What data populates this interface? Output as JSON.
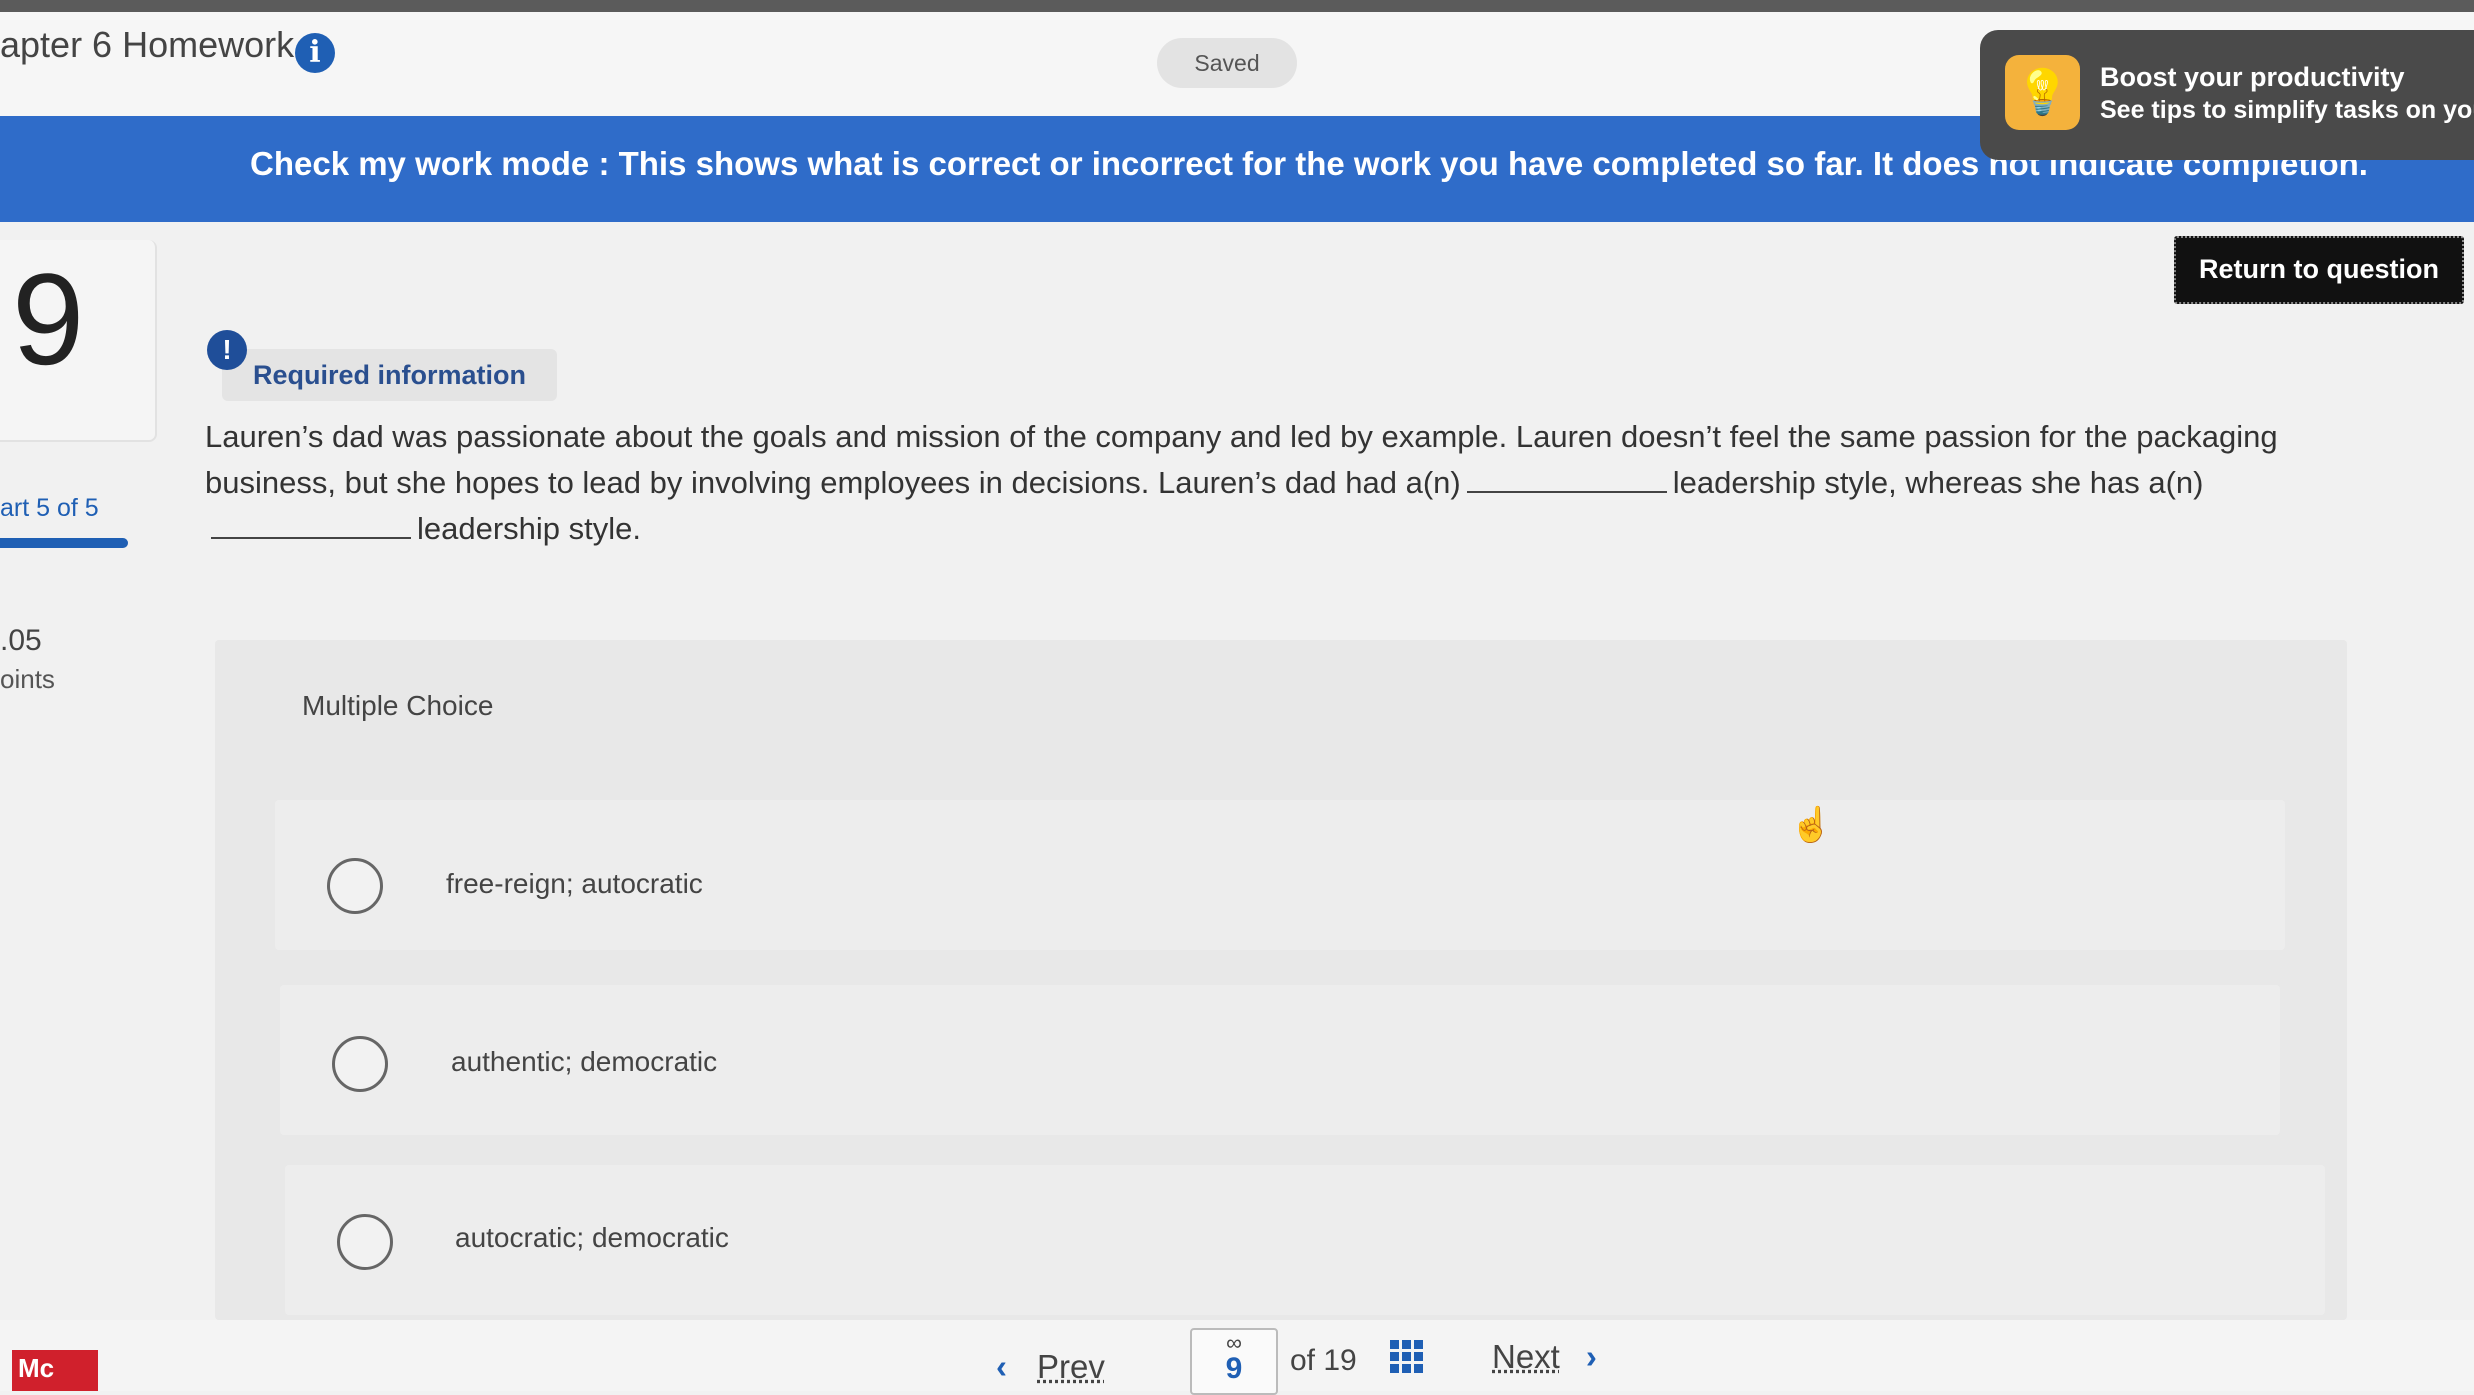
{
  "header": {
    "assignment_title": "apter 6 Homework",
    "saved_label": "Saved"
  },
  "banner": {
    "text": "Check my work mode : This shows what is correct or incorrect for the work you have completed so far. It does not indicate completion."
  },
  "tip": {
    "title": "Boost your productivity",
    "subtitle": "See tips to simplify tasks on you"
  },
  "return_button": "Return to question",
  "sidebar": {
    "question_number": "9",
    "part_label": "art 5 of 5",
    "points_value": ".05",
    "points_label": "oints",
    "part_progress": 1.0
  },
  "question": {
    "required_label": "Required information",
    "text_part1": "Lauren’s dad was passionate about the goals and mission of the company and led by example. Lauren doesn’t feel the same passion for the packaging business, but she hopes to lead by involving employees in decisions. Lauren’s dad had a(n)",
    "text_part2": "leadership style, whereas she has a(n)",
    "text_part3": "leadership style."
  },
  "multiple_choice": {
    "label": "Multiple Choice",
    "options": [
      {
        "text": "free-reign; autocratic"
      },
      {
        "text": "authentic; democratic"
      },
      {
        "text": "autocratic; democratic"
      }
    ]
  },
  "navigation": {
    "prev_label": "Prev",
    "next_label": "Next",
    "current_page": "9",
    "total_label": "of  19"
  },
  "logo": {
    "text": "Mc"
  },
  "colors": {
    "banner_blue": "#2f6cc9",
    "accent_blue": "#1f5fb4",
    "logo_red": "#d0202c"
  }
}
